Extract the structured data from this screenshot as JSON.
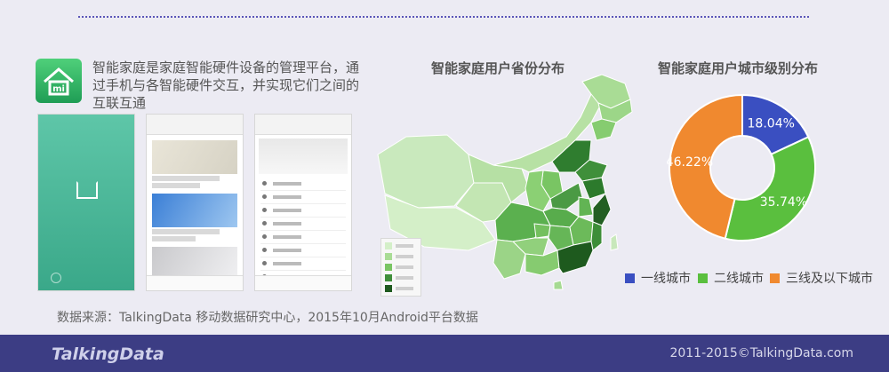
{
  "description": "智能家庭是家庭智能硬件设备的管理平台，通过手机与各智能硬件交互，并实现它们之间的互联互通",
  "map_title": "智能家庭用户省份分布",
  "donut_title": "智能家庭用户城市级别分布",
  "source": "数据来源：TalkingData 移动数据研究中心，2015年10月Android平台数据",
  "footer": {
    "logo": "TalkingData",
    "copyright": "2011-2015©TalkingData.com"
  },
  "colors": {
    "tier1": "#3a4fc1",
    "tier2": "#5abf3e",
    "tier3": "#f0892f",
    "footer": "#3c3d84",
    "accent": "#5b56b8"
  },
  "icons": [
    "home-icon",
    "talkingdata-logo-icon"
  ],
  "chart_data": {
    "type": "pie",
    "categories": [
      "一线城市",
      "二线城市",
      "三线及以下城市"
    ],
    "values": [
      18.04,
      35.74,
      46.22
    ],
    "value_labels": [
      "18.04%",
      "35.74%",
      "46.22%"
    ],
    "legend": "bottom"
  }
}
